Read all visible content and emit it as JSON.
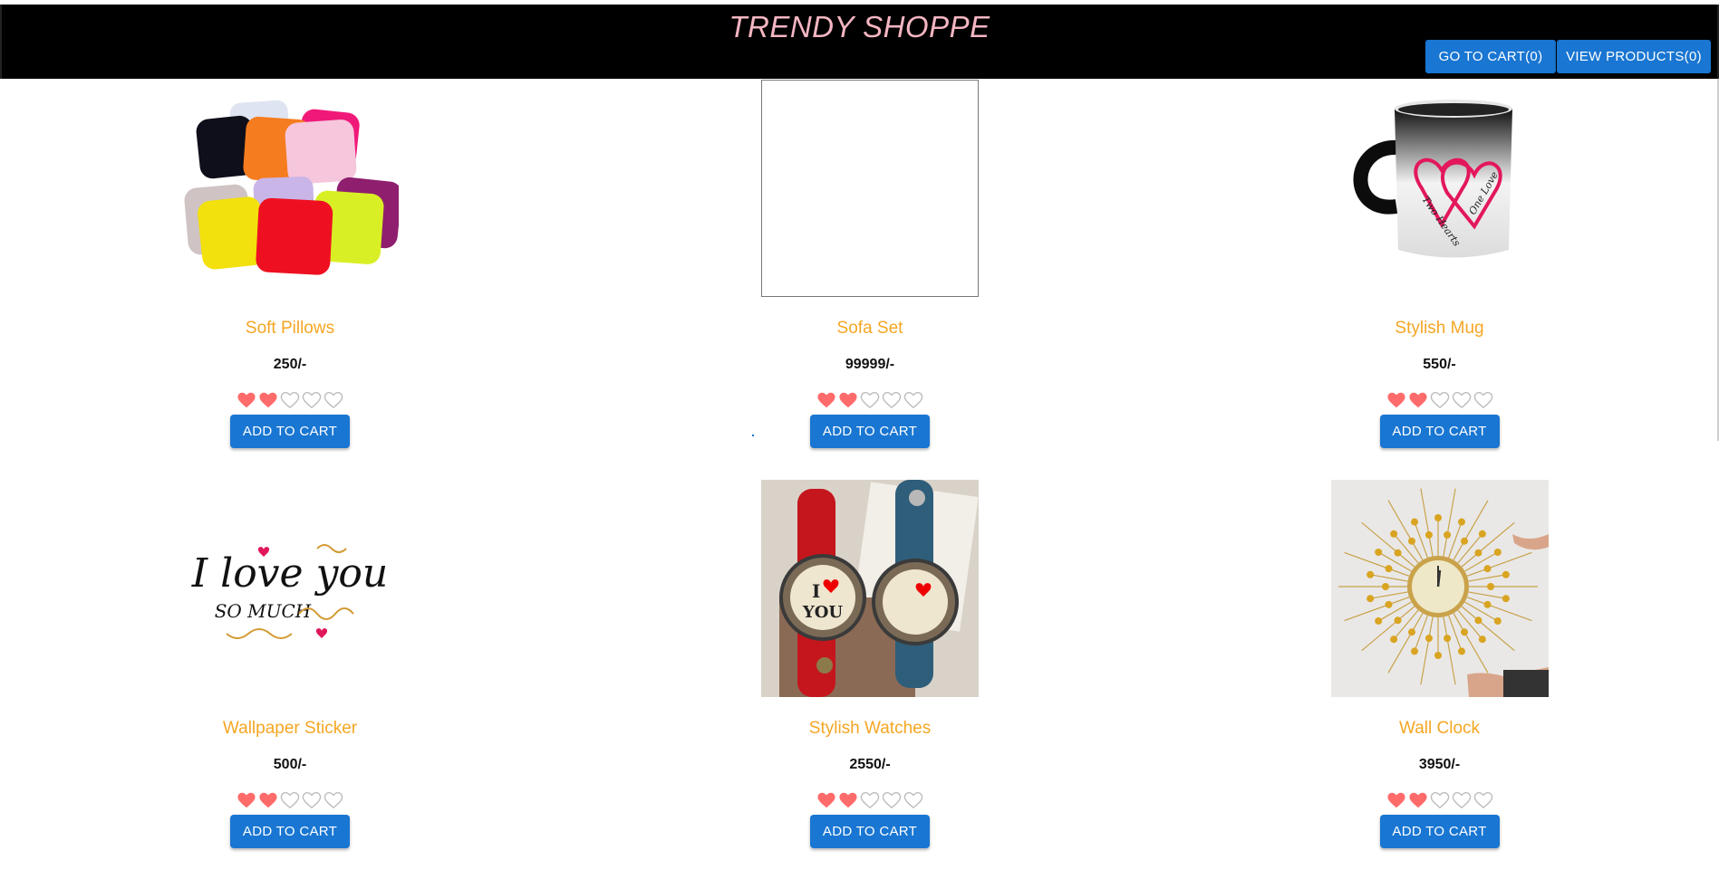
{
  "header": {
    "brand": "TRENDY SHOPPE",
    "go_to_cart_label": "GO TO CART(0)",
    "view_products_label": "VIEW PRODUCTS(0)"
  },
  "products": [
    {
      "name": "Soft Pillows",
      "price": "250/-",
      "rating": 2,
      "rating_max": 5,
      "button_label": "ADD TO CART",
      "image": "pillows"
    },
    {
      "name": "Sofa Set",
      "price": "99999/-",
      "rating": 2,
      "rating_max": 5,
      "button_label": "ADD TO CART",
      "image": "blank"
    },
    {
      "name": "Stylish Mug",
      "price": "550/-",
      "rating": 2,
      "rating_max": 5,
      "button_label": "ADD TO CART",
      "image": "mug"
    },
    {
      "name": "Wallpaper Sticker",
      "price": "500/-",
      "rating": 2,
      "rating_max": 5,
      "button_label": "ADD TO CART",
      "image": "sticker"
    },
    {
      "name": "Stylish Watches",
      "price": "2550/-",
      "rating": 2,
      "rating_max": 5,
      "button_label": "ADD TO CART",
      "image": "watches"
    },
    {
      "name": "Wall Clock",
      "price": "3950/-",
      "rating": 2,
      "rating_max": 5,
      "button_label": "ADD TO CART",
      "image": "clock"
    }
  ],
  "mug_text": {
    "left": "Two Hearts",
    "right": "One Love"
  },
  "sticker_text": {
    "line1": "I love you",
    "line2": "SO MUCH"
  },
  "watch_text": {
    "line1": "I",
    "line2": "YOU"
  },
  "colors": {
    "header_bg": "#000000",
    "brand": "#f4b6c2",
    "accent": "#1976d2",
    "product_name": "#f5a623",
    "heart_filled": "#ff6b6b",
    "heart_empty": "#bdbdbd"
  }
}
